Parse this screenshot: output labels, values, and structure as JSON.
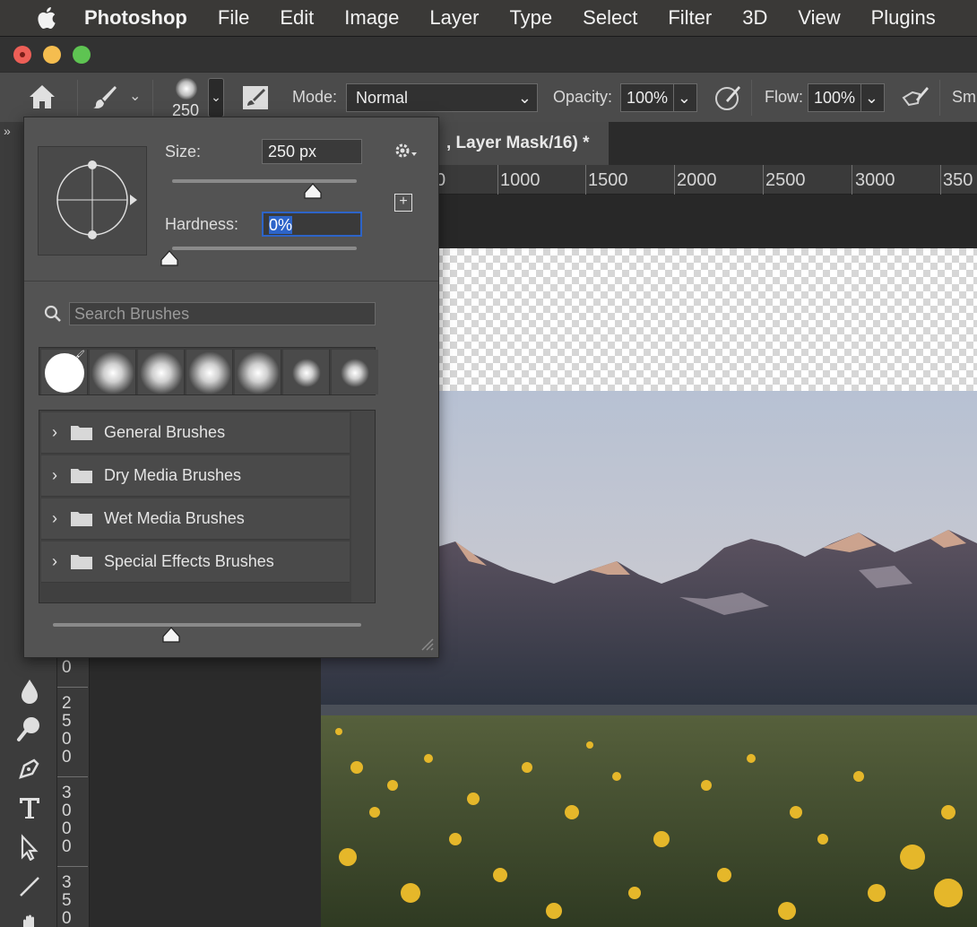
{
  "menubar": {
    "app_name": "Photoshop",
    "items": [
      "File",
      "Edit",
      "Image",
      "Layer",
      "Type",
      "Select",
      "Filter",
      "3D",
      "View",
      "Plugins"
    ]
  },
  "options_bar": {
    "brush_size": "250",
    "mode_label": "Mode:",
    "mode_value": "Normal",
    "opacity_label": "Opacity:",
    "opacity_value": "100%",
    "flow_label": "Flow:",
    "flow_value": "100%",
    "smoothing_label": "Sm"
  },
  "document": {
    "tab_title": ", Layer Mask/16) *",
    "ruler_ticks": [
      "0",
      "1000",
      "1500",
      "2000",
      "2500",
      "3000",
      "350"
    ],
    "vertical_ruler": [
      "0",
      "2",
      "5",
      "0",
      "0",
      "3",
      "0",
      "0",
      "0",
      "3",
      "5",
      "0"
    ]
  },
  "brush_panel": {
    "size_label": "Size:",
    "size_value": "250 px",
    "hardness_label": "Hardness:",
    "hardness_value": "0%",
    "size_slider_fraction": 0.76,
    "hardness_slider_fraction": 0.0,
    "search_placeholder": "Search Brushes",
    "folders": [
      "General Brushes",
      "Dry Media Brushes",
      "Wet Media Brushes",
      "Special Effects Brushes"
    ]
  },
  "colors": {
    "menubar_bg": "#3a3937",
    "panel_bg": "#535353",
    "selection_highlight": "#2d64c8"
  }
}
